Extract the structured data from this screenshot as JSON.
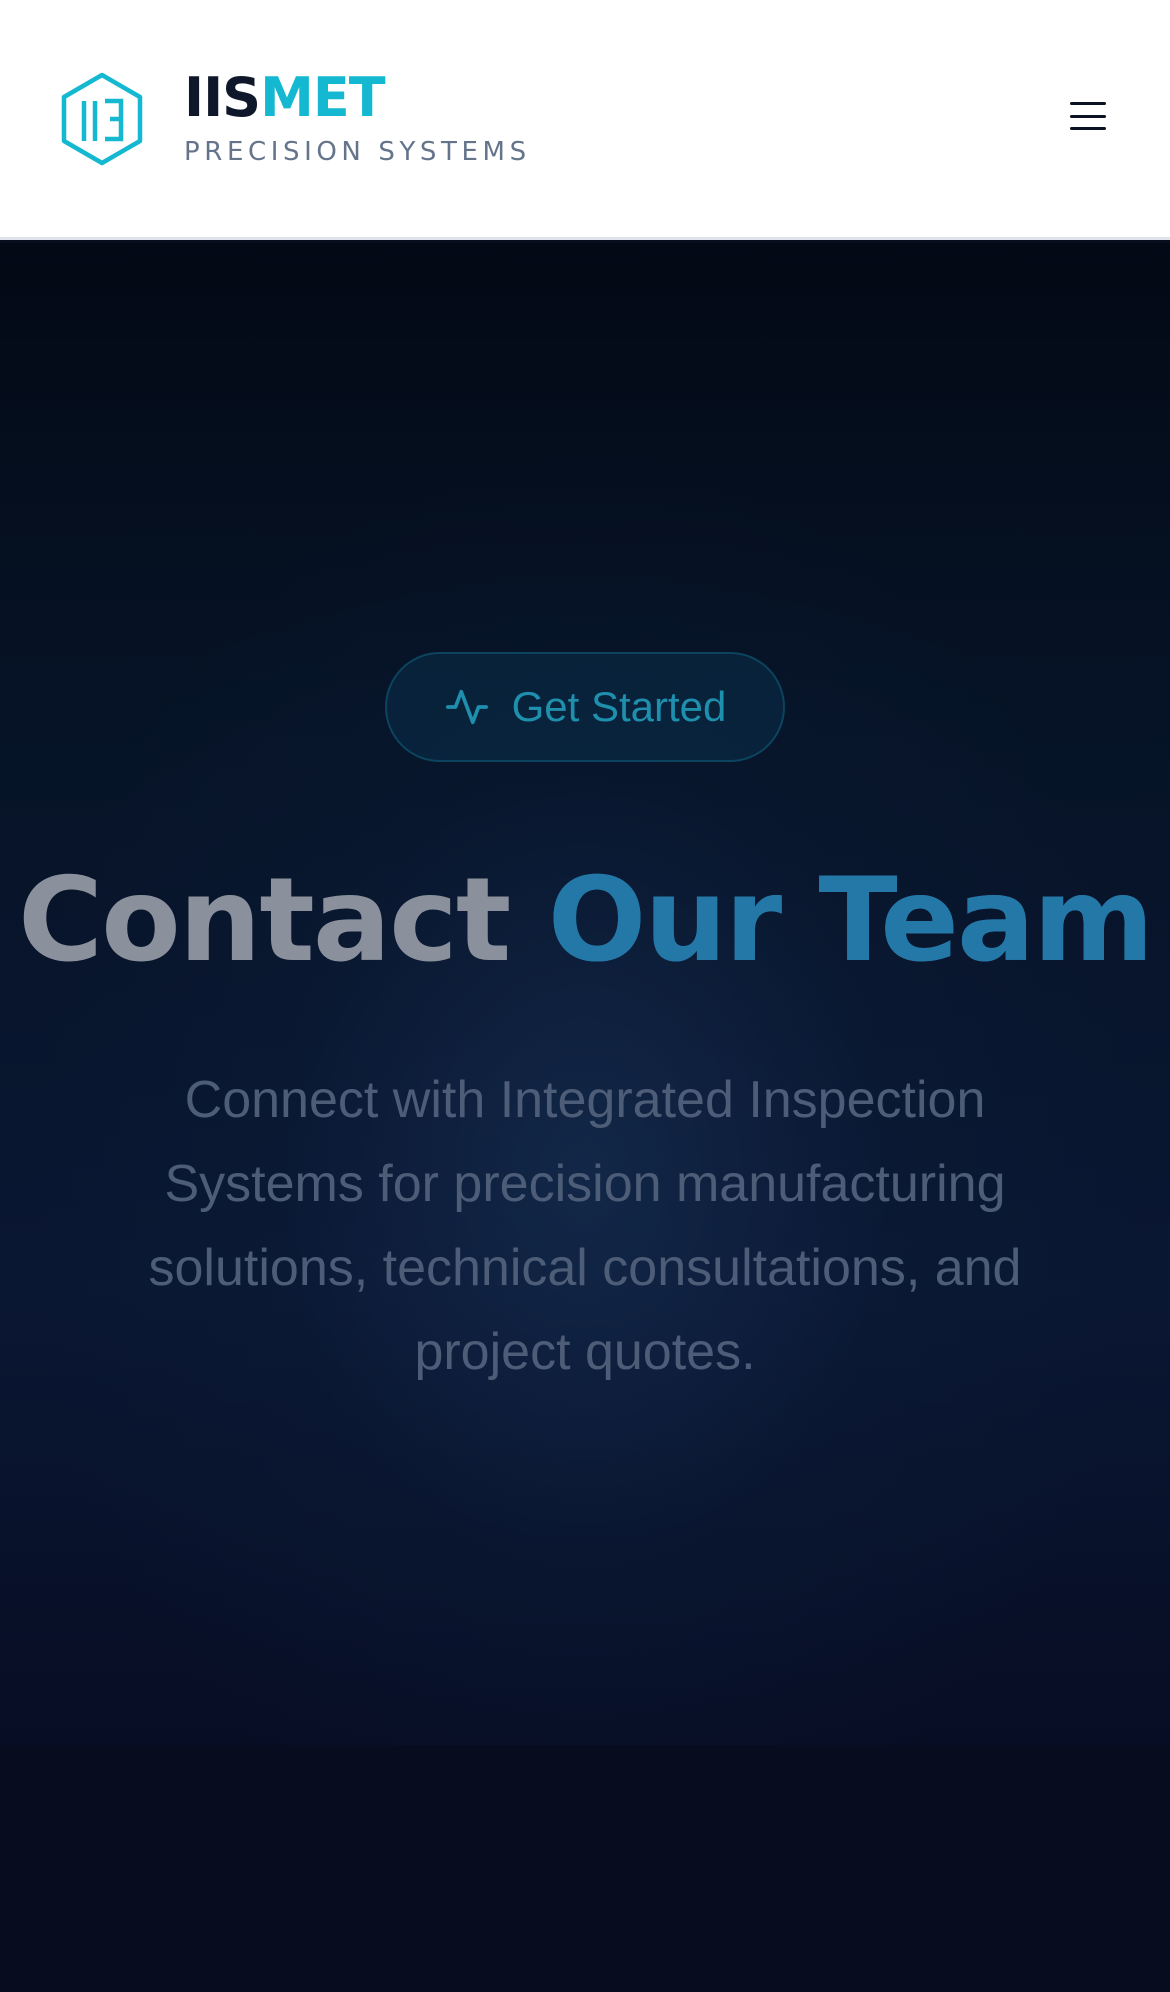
{
  "header": {
    "brand_part_a": "IIS",
    "brand_part_b": "MET",
    "tagline": "PRECISION SYSTEMS",
    "logo_icon": "hexagon-logo-icon",
    "menu_icon": "hamburger-menu-icon"
  },
  "hero": {
    "badge_icon": "activity-pulse-icon",
    "badge_label": "Get Started",
    "title_part_a": "Contact",
    "title_part_b": "Our Team",
    "description": "Connect with Integrated Inspection Systems for precision manufacturing solutions, technical consultations, and project quotes."
  },
  "colors": {
    "accent": "#14b8d0",
    "brand_dark": "#0f172a",
    "hero_bg": "#061326",
    "page_bg": "#080c1f"
  }
}
